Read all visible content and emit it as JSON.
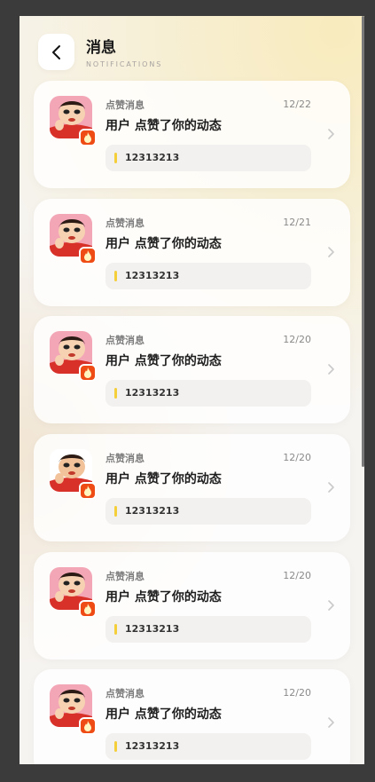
{
  "header": {
    "title": "消息",
    "subtitle": "NOTIFICATIONS",
    "back_icon": "chevron-left-icon"
  },
  "colors": {
    "badge": "#ef4b14",
    "quote_accent": "#f4cf3a",
    "background_tint": "#f8ebbd"
  },
  "notifications": [
    {
      "type": "点赞消息",
      "date": "12/22",
      "message": "用户 点赞了你的动态",
      "quote": "12313213",
      "badge_icon": "fire-icon"
    },
    {
      "type": "点赞消息",
      "date": "12/21",
      "message": "用户 点赞了你的动态",
      "quote": "12313213",
      "badge_icon": "fire-icon"
    },
    {
      "type": "点赞消息",
      "date": "12/20",
      "message": "用户 点赞了你的动态",
      "quote": "12313213",
      "badge_icon": "fire-icon"
    },
    {
      "type": "点赞消息",
      "date": "12/20",
      "message": "用户 点赞了你的动态",
      "quote": "12313213",
      "badge_icon": "fire-icon"
    },
    {
      "type": "点赞消息",
      "date": "12/20",
      "message": "用户 点赞了你的动态",
      "quote": "12313213",
      "badge_icon": "fire-icon"
    },
    {
      "type": "点赞消息",
      "date": "12/20",
      "message": "用户 点赞了你的动态",
      "quote": "12313213",
      "badge_icon": "fire-icon"
    }
  ]
}
